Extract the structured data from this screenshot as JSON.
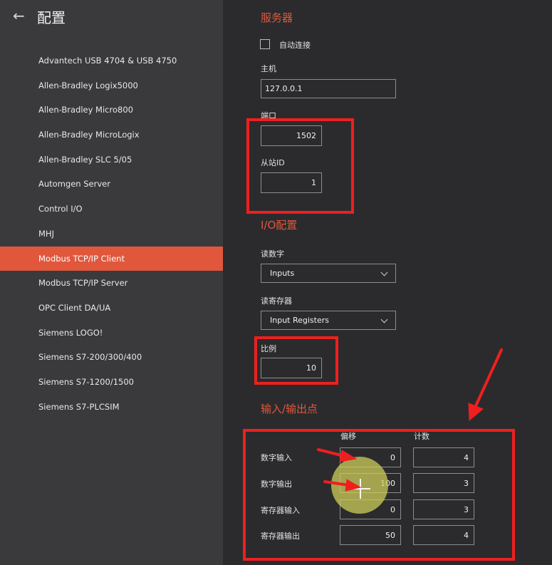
{
  "sidebar": {
    "title": "配置",
    "items": [
      {
        "label": "Advantech USB 4704 & USB 4750"
      },
      {
        "label": "Allen-Bradley Logix5000"
      },
      {
        "label": "Allen-Bradley Micro800"
      },
      {
        "label": "Allen-Bradley MicroLogix"
      },
      {
        "label": "Allen-Bradley SLC 5/05"
      },
      {
        "label": "Automgen Server"
      },
      {
        "label": "Control I/O"
      },
      {
        "label": "MHJ"
      },
      {
        "label": "Modbus TCP/IP Client",
        "active": true
      },
      {
        "label": "Modbus TCP/IP Server"
      },
      {
        "label": "OPC Client DA/UA"
      },
      {
        "label": "Siemens LOGO!"
      },
      {
        "label": "Siemens S7-200/300/400"
      },
      {
        "label": "Siemens S7-1200/1500"
      },
      {
        "label": "Siemens S7-PLCSIM"
      }
    ]
  },
  "server": {
    "section_title": "服务器",
    "auto_connect_label": "自动连接",
    "auto_connect_checked": false,
    "host_label": "主机",
    "host_value": "127.0.0.1",
    "port_label": "端口",
    "port_value": "1502",
    "slave_id_label": "从站ID",
    "slave_id_value": "1"
  },
  "io_config": {
    "section_title": "I/O配置",
    "read_digital_label": "读数字",
    "read_digital_value": "Inputs",
    "read_register_label": "读寄存器",
    "read_register_value": "Input Registers",
    "scale_label": "比例",
    "scale_value": "10"
  },
  "io_points": {
    "section_title": "输入/输出点",
    "offset_header": "偏移",
    "count_header": "计数",
    "rows": [
      {
        "label": "数字输入",
        "offset": "0",
        "count": "4"
      },
      {
        "label": "数字输出",
        "offset": "100",
        "count": "3"
      },
      {
        "label": "寄存器输入",
        "offset": "0",
        "count": "3"
      },
      {
        "label": "寄存器输出",
        "offset": "50",
        "count": "4"
      }
    ]
  },
  "colors": {
    "accent": "#e0573c",
    "highlight": "#ef1f1f",
    "sidebar_bg": "#3a3a3c",
    "main_bg": "#2b2b2d"
  }
}
